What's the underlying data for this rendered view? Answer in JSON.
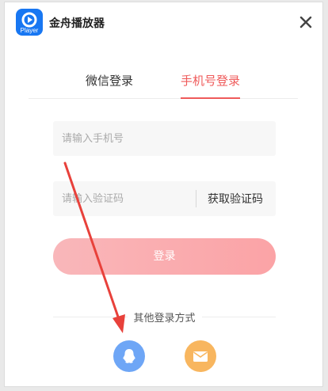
{
  "app": {
    "title": "金舟播放器",
    "logo_text": "Player",
    "brand_color": "#1877f2"
  },
  "tabs": [
    {
      "label": "微信登录",
      "active": false
    },
    {
      "label": "手机号登录",
      "active": true
    }
  ],
  "form": {
    "phone_placeholder": "请输入手机号",
    "code_placeholder": "请输入验证码",
    "get_code_label": "获取验证码",
    "login_label": "登录"
  },
  "other_login": {
    "label": "其他登录方式",
    "options": [
      {
        "icon": "qq-icon",
        "color": "#6ea6f6"
      },
      {
        "icon": "mail-icon",
        "color": "#f8b65f"
      }
    ]
  },
  "colors": {
    "accent": "#ef5a5a",
    "annotation_arrow": "#e8413b"
  }
}
